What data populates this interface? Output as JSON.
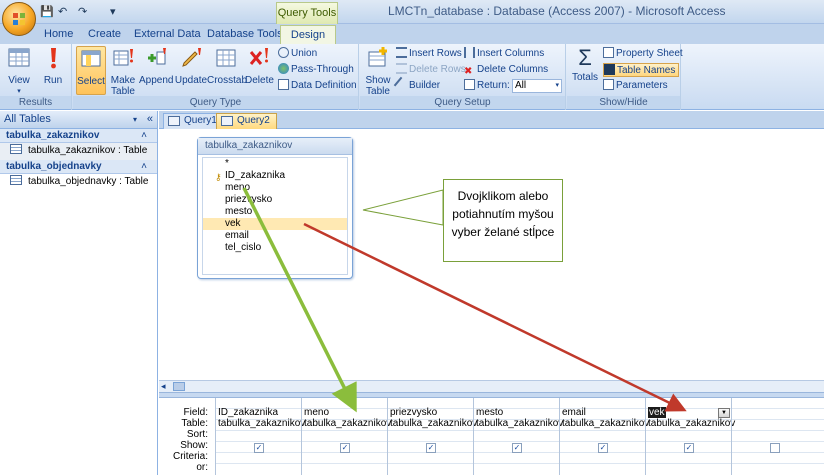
{
  "window": {
    "title": "LMCTn_database : Database (Access 2007) - Microsoft Access",
    "contextual_tab": "Query Tools"
  },
  "tabs": [
    "Home",
    "Create",
    "External Data",
    "Database Tools",
    "Design"
  ],
  "ribbon": {
    "results": {
      "label": "Results",
      "view": "View",
      "run": "Run"
    },
    "query_type": {
      "label": "Query Type",
      "select": "Select",
      "make_table": "Make Table",
      "append": "Append",
      "update": "Update",
      "crosstab": "Crosstab",
      "delete": "Delete",
      "union": "Union",
      "pass_through": "Pass-Through",
      "data_definition": "Data Definition"
    },
    "query_setup": {
      "label": "Query Setup",
      "show_table": "Show Table",
      "insert_rows": "Insert Rows",
      "delete_rows": "Delete Rows",
      "builder": "Builder",
      "insert_columns": "Insert Columns",
      "delete_columns": "Delete Columns",
      "return_label": "Return:",
      "return_value": "All"
    },
    "show_hide": {
      "label": "Show/Hide",
      "totals": "Totals",
      "property_sheet": "Property Sheet",
      "table_names": "Table Names",
      "parameters": "Parameters"
    }
  },
  "nav": {
    "header": "All Tables",
    "groups": [
      {
        "name": "tabulka_zakaznikov",
        "item": "tabulka_zakaznikov : Table"
      },
      {
        "name": "tabulka_objednavky",
        "item": "tabulka_objednavky : Table"
      }
    ]
  },
  "doc_tabs": [
    "Query1",
    "Query2"
  ],
  "table_box": {
    "title": "tabulka_zakaznikov",
    "fields": [
      "*",
      "ID_zakaznika",
      "meno",
      "priezvysko",
      "mesto",
      "vek",
      "email",
      "tel_cislo"
    ]
  },
  "callout": {
    "text": "Dvojklikom alebo potiahnutím myšou vyber želané stĺpce"
  },
  "grid": {
    "row_labels": [
      "Field:",
      "Table:",
      "Sort:",
      "Show:",
      "Criteria:",
      "or:"
    ],
    "columns": [
      {
        "field": "ID_zakaznika",
        "table": "tabulka_zakaznikov",
        "show": "✓"
      },
      {
        "field": "meno",
        "table": "tabulka_zakaznikov",
        "show": "✓"
      },
      {
        "field": "priezvysko",
        "table": "tabulka_zakaznikov",
        "show": "✓"
      },
      {
        "field": "mesto",
        "table": "tabulka_zakaznikov",
        "show": "✓"
      },
      {
        "field": "email",
        "table": "tabulka_zakaznikov",
        "show": "✓"
      },
      {
        "field": "vek",
        "table": "tabulka_zakaznikov",
        "show": "✓"
      },
      {
        "field": "",
        "table": "",
        "show": ""
      }
    ]
  },
  "colors": {
    "arrow_green": "#8bbd3c",
    "arrow_red": "#c0392b",
    "accent": "#15428b"
  }
}
